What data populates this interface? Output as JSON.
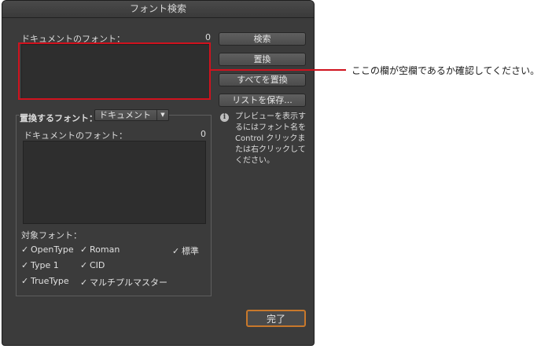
{
  "window": {
    "title": "フォント検索"
  },
  "doc_fonts": {
    "label": "ドキュメントのフォント：",
    "count": "0"
  },
  "buttons": {
    "find": "検索",
    "replace": "置換",
    "replace_all": "すべてを置換",
    "save_list": "リストを保存...",
    "done": "完了"
  },
  "replace_section": {
    "label": "置換するフォント：",
    "dropdown_value": "ドキュメント",
    "list_label": "ドキュメントのフォント：",
    "list_count": "0"
  },
  "target_fonts": {
    "label": "対象フォント：",
    "checkboxes": [
      {
        "label": "OpenType",
        "checked": true
      },
      {
        "label": "Roman",
        "checked": true
      },
      {
        "label": "標準",
        "checked": true
      },
      {
        "label": "Type 1",
        "checked": true
      },
      {
        "label": "CID",
        "checked": true
      },
      {
        "label": "TrueType",
        "checked": true
      },
      {
        "label": "マルチプルマスター",
        "checked": true
      }
    ]
  },
  "info": {
    "icon": "info-icon",
    "text": "プレビューを表示するにはフォント名をControl クリックまたは右クリックしてください。"
  },
  "annotation": {
    "text": "ここの欄が空欄であるか確認してください。",
    "color": "#d0121e"
  }
}
